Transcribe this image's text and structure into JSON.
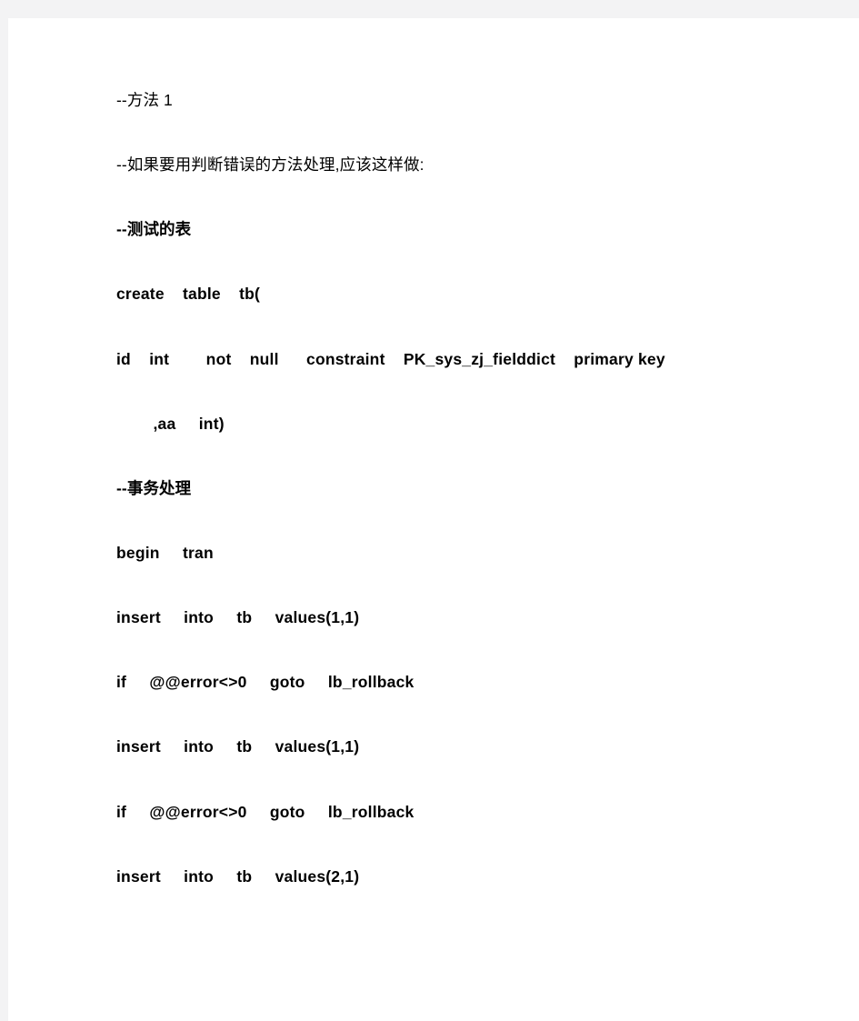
{
  "document": {
    "page_background": "#ffffff",
    "viewer_background": "#f3f3f4",
    "text_color": "#000000",
    "paragraphs": [
      {
        "id": "p1",
        "text": "--方法 1",
        "bold": false
      },
      {
        "id": "p2",
        "text": "--如果要用判断错误的方法处理,应该这样做:",
        "bold": false
      },
      {
        "id": "p3",
        "text": "--测试的表",
        "bold": true
      },
      {
        "id": "p4",
        "text": "create    table    tb(",
        "bold": true
      },
      {
        "id": "p5",
        "text": "id    int        not    null      constraint    PK_sys_zj_fielddict    primary key",
        "bold": true
      },
      {
        "id": "p6",
        "text": "        ,aa     int)",
        "bold": true
      },
      {
        "id": "p7",
        "text": "--事务处理",
        "bold": true
      },
      {
        "id": "p8",
        "text": "begin     tran",
        "bold": true
      },
      {
        "id": "p9",
        "text": "insert     into     tb     values(1,1)",
        "bold": true
      },
      {
        "id": "p10",
        "text": "if     @@error<>0     goto     lb_rollback",
        "bold": true
      },
      {
        "id": "p11",
        "text": "insert     into     tb     values(1,1)",
        "bold": true
      },
      {
        "id": "p12",
        "text": "if     @@error<>0     goto     lb_rollback",
        "bold": true
      },
      {
        "id": "p13",
        "text": "insert     into     tb     values(2,1)",
        "bold": true
      }
    ]
  }
}
